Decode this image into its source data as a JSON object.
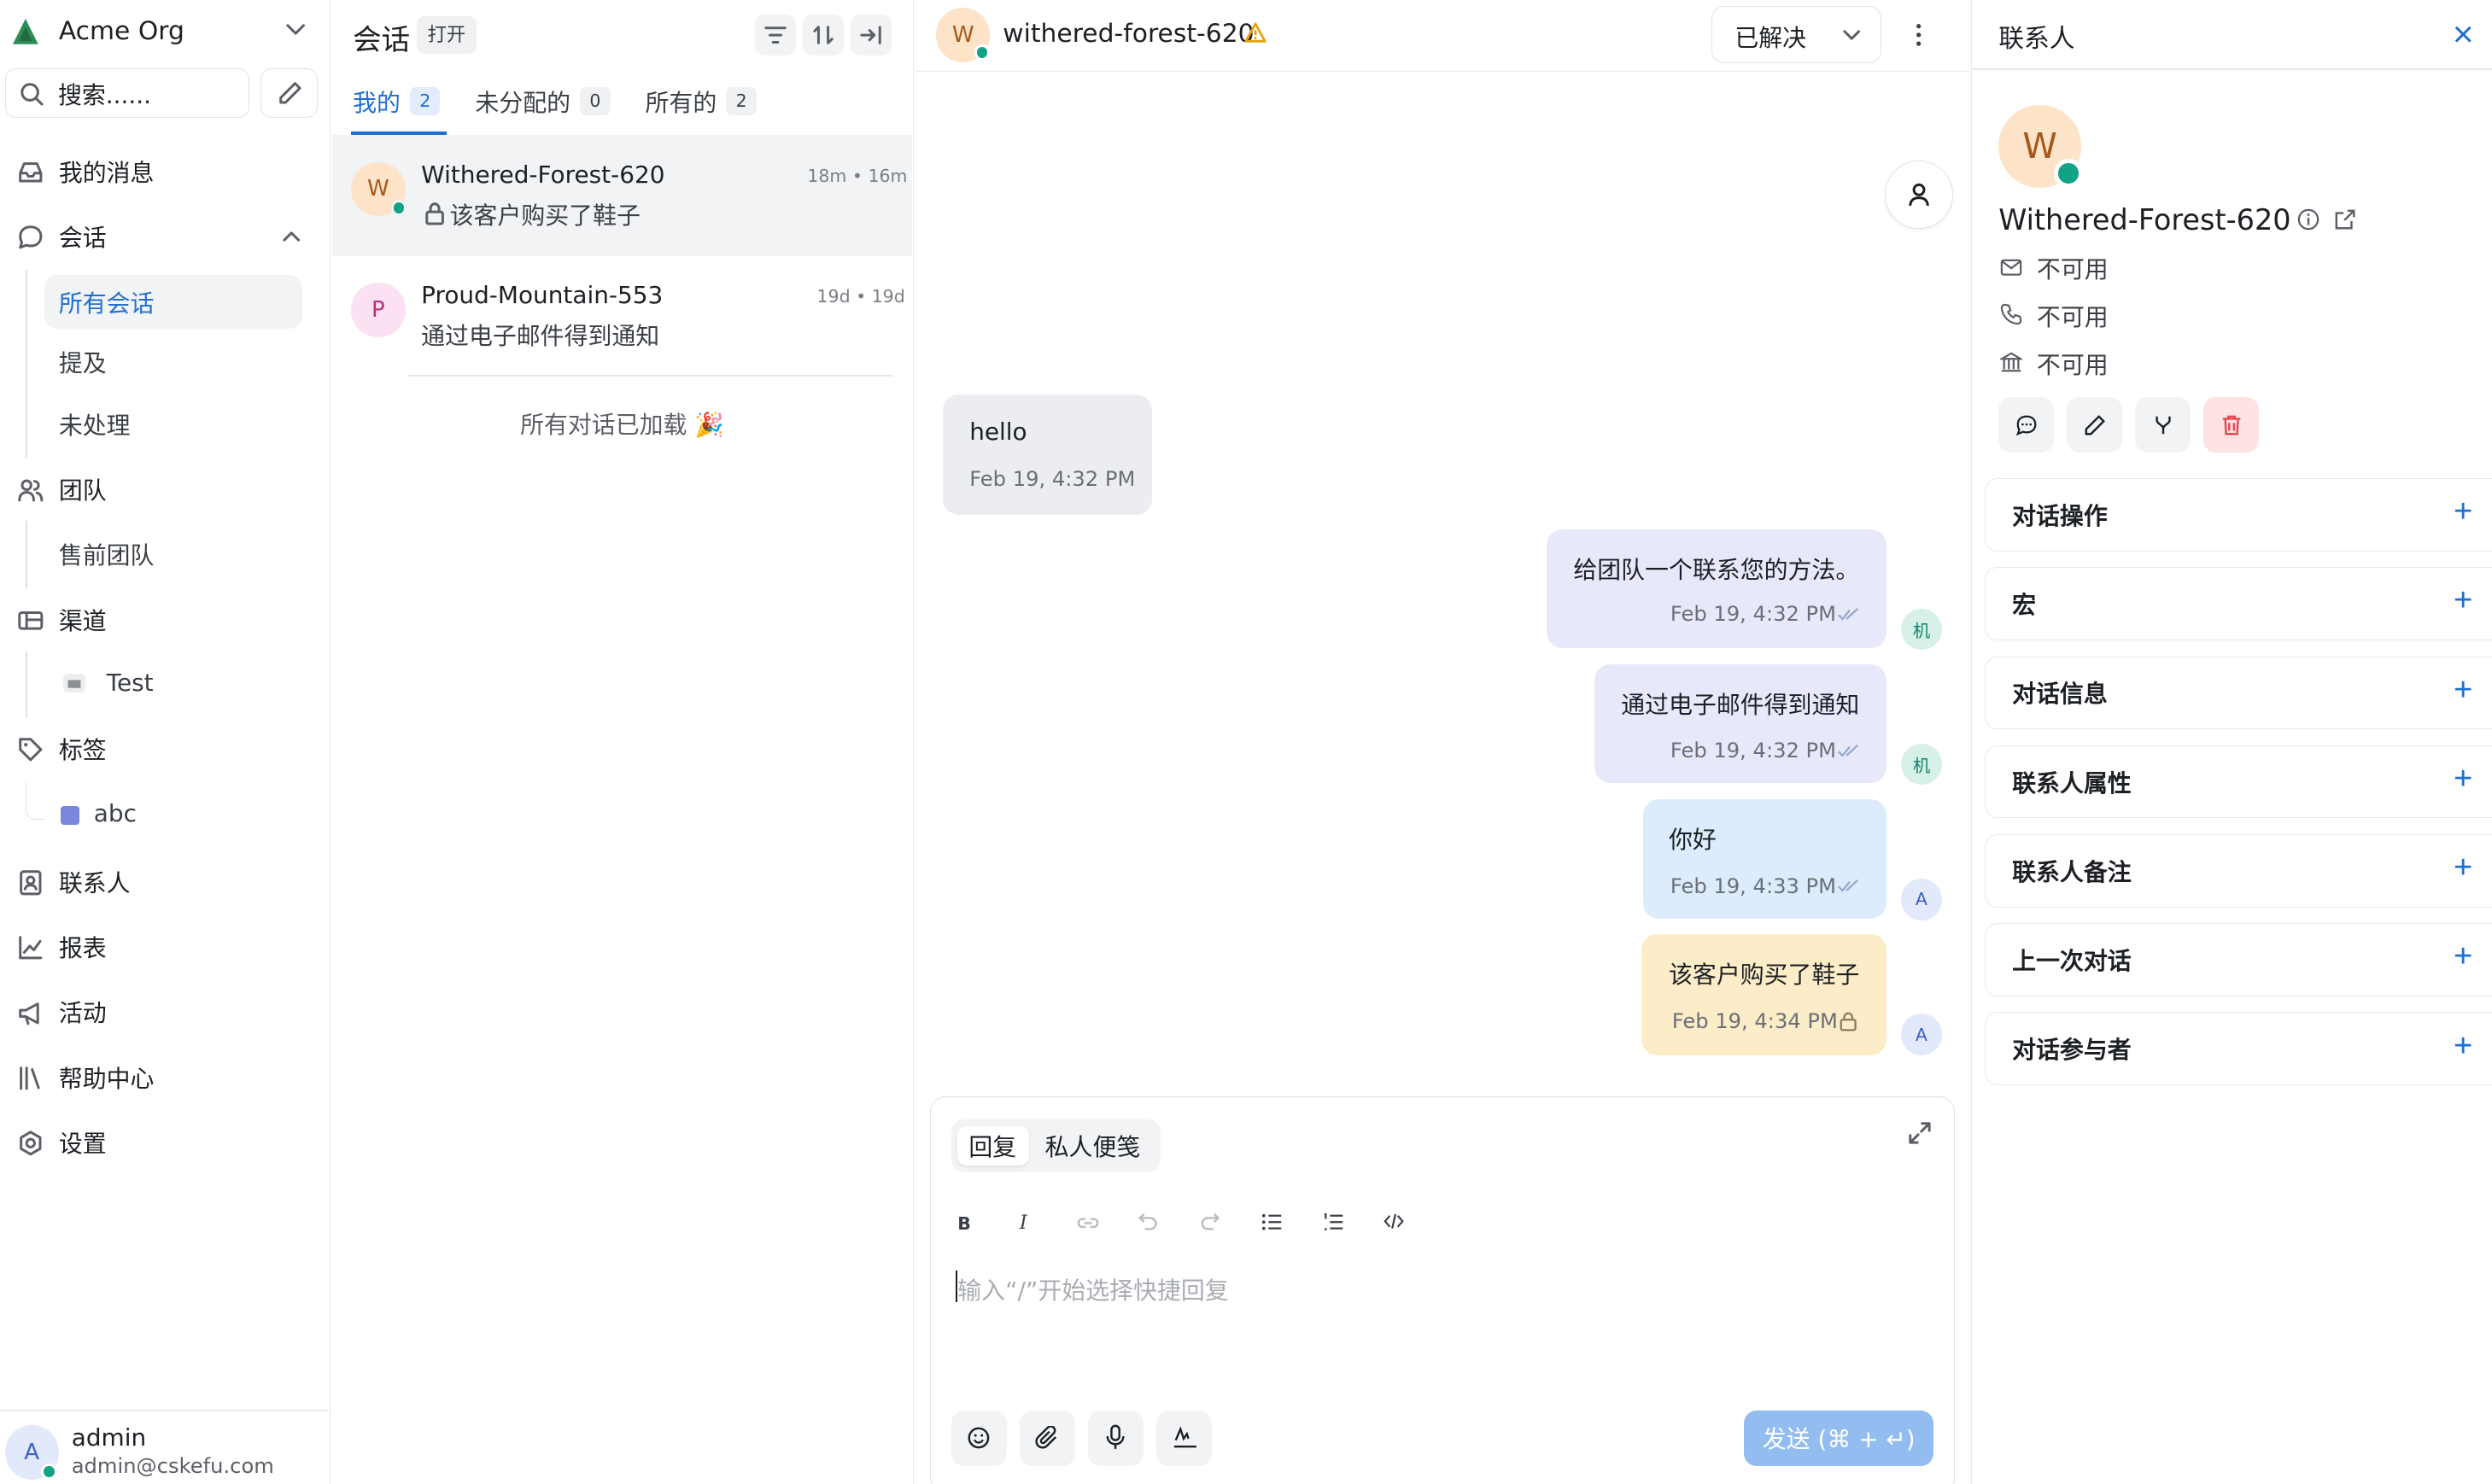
{
  "org": {
    "name": "Acme Org"
  },
  "search": {
    "placeholder": "搜索......"
  },
  "nav": {
    "inbox": "我的消息",
    "conversations": "会话",
    "sub_conversations": [
      "所有会话",
      "提及",
      "未处理"
    ],
    "teams": "团队",
    "teams_items": [
      "售前团队"
    ],
    "channels": "渠道",
    "channels_items": [
      "Test"
    ],
    "labels": "标签",
    "labels_items": [
      "abc"
    ],
    "contacts": "联系人",
    "reports": "报表",
    "campaigns": "活动",
    "help_center": "帮助中心",
    "settings": "设置"
  },
  "user": {
    "initial": "A",
    "name": "admin",
    "email": "admin@cskefu.com"
  },
  "convlist": {
    "title": "会话",
    "status_badge": "打开",
    "tabs": [
      {
        "label": "我的",
        "count": "2"
      },
      {
        "label": "未分配的",
        "count": "0"
      },
      {
        "label": "所有的",
        "count": "2"
      }
    ],
    "items": [
      {
        "initial": "W",
        "name": "Withered-Forest-620",
        "time": "18m • 16m",
        "preview": "该客户购买了鞋子"
      },
      {
        "initial": "P",
        "name": "Proud-Mountain-553",
        "time": "19d • 19d",
        "preview": "通过电子邮件得到通知"
      }
    ],
    "footer": "所有对话已加载 🎉"
  },
  "chat": {
    "header": {
      "initial": "W",
      "name": "withered-forest-620",
      "status": "已解决"
    },
    "messages": [
      {
        "text": "hello",
        "time": "Feb 19, 4:32 PM"
      },
      {
        "text": "给团队一个联系您的方法。",
        "time": "Feb 19, 4:32 PM",
        "sender": "机"
      },
      {
        "text": "通过电子邮件得到通知",
        "time": "Feb 19, 4:32 PM",
        "sender": "机"
      },
      {
        "text": "你好",
        "time": "Feb 19, 4:33 PM",
        "sender": "A"
      },
      {
        "text": "该客户购买了鞋子",
        "time": "Feb 19, 4:34 PM",
        "sender": "A"
      }
    ],
    "composer": {
      "reply_tab": "回复",
      "note_tab": "私人便笺",
      "placeholder": "输入“/”开始选择快捷回复",
      "send": "发送 (⌘ + ↵)"
    }
  },
  "contact": {
    "title": "联系人",
    "initial": "W",
    "name": "Withered-Forest-620",
    "email": "不可用",
    "phone": "不可用",
    "company": "不可用",
    "sections": [
      "对话操作",
      "宏",
      "对话信息",
      "联系人属性",
      "联系人备注",
      "上一次对话",
      "对话参与者"
    ]
  },
  "colors": {
    "accent": "#1f6fd1",
    "online": "#12a386",
    "outgoing_bubble": "#e8e8fb",
    "agent_bubble": "#dcecfd",
    "private_bubble": "#fcecc8",
    "incoming_bubble": "#ecedf0",
    "send_button": "#93bdf0",
    "delete_button": "#fde3e3"
  }
}
